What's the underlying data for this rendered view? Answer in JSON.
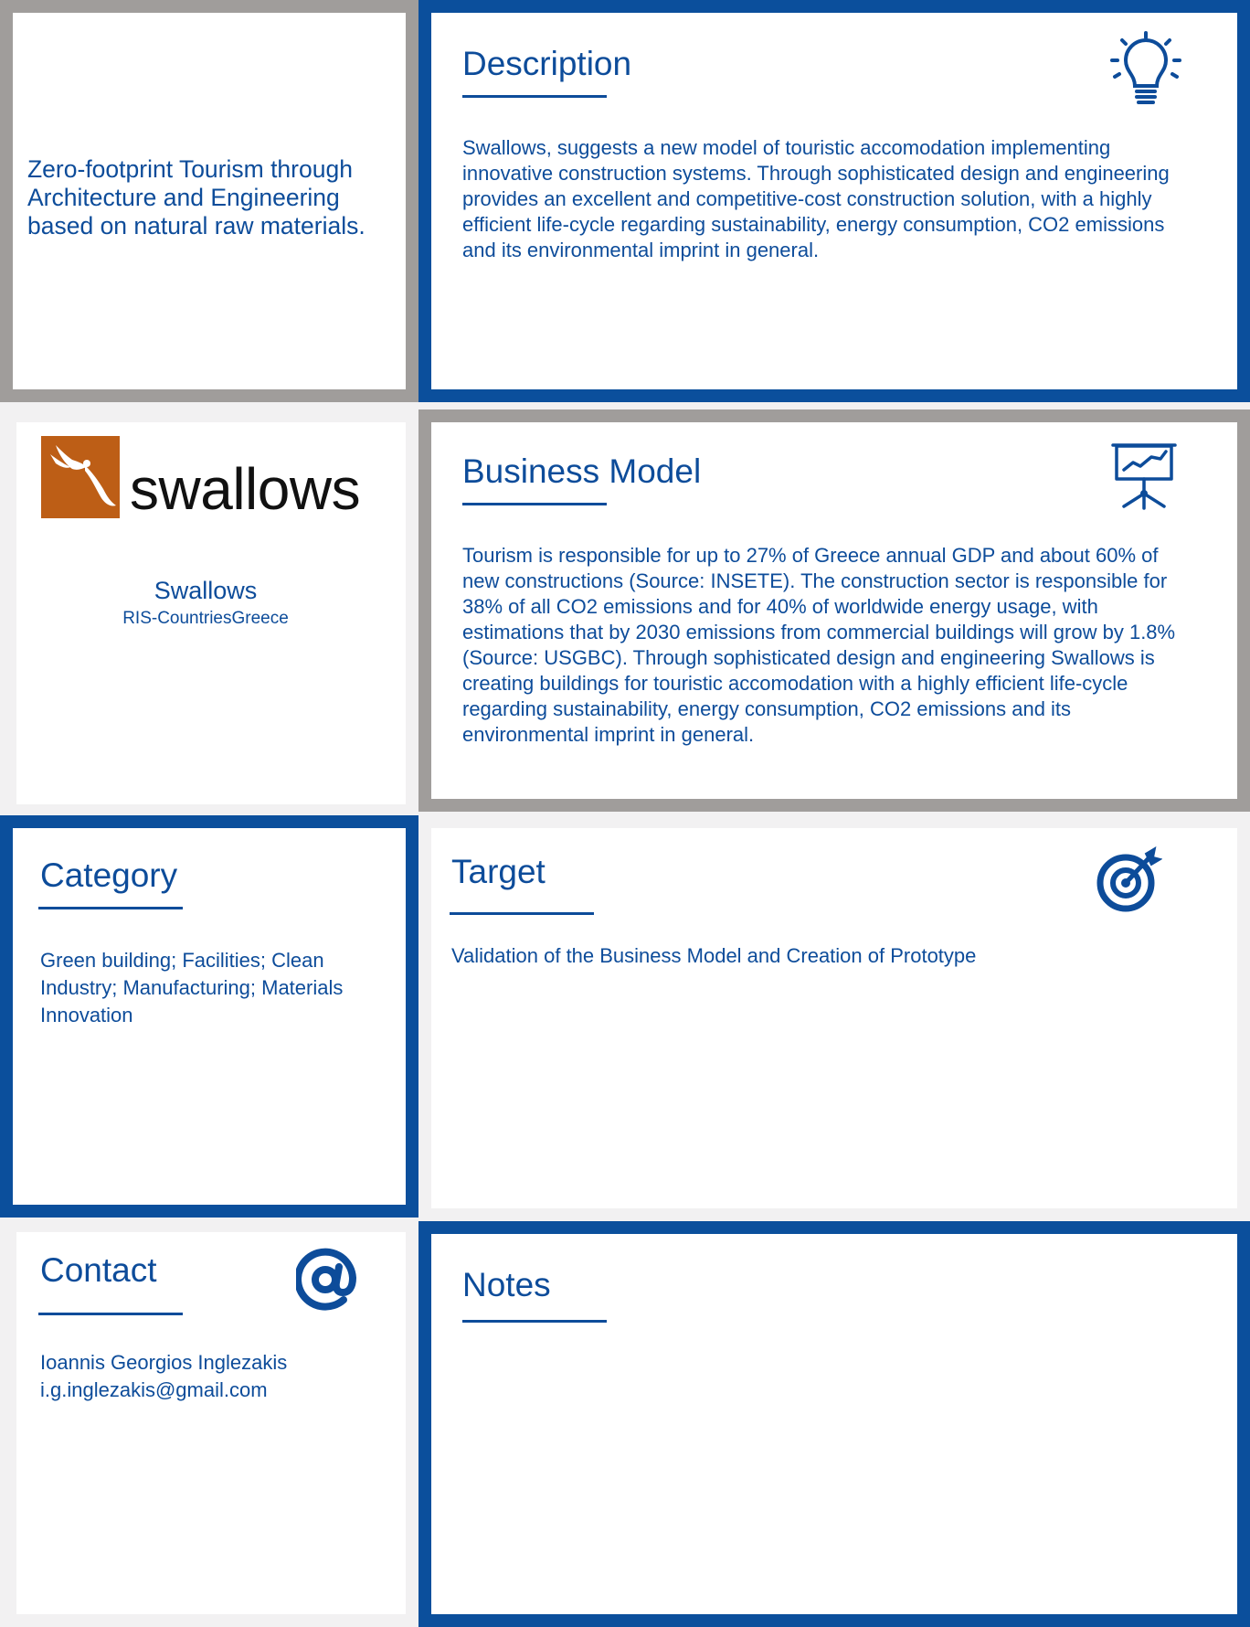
{
  "intro": {
    "tagline": "Zero-footprint Tourism through Architecture and Engineering based on natural raw materials."
  },
  "description": {
    "title": "Description",
    "icon": "lightbulb-icon",
    "text": "Swallows, suggests a new model of touristic accomodation implementing innovative construction systems. Through sophisticated design and engineering provides an excellent and competitive-cost construction solution, with a highly efficient life-cycle regarding sustainability, energy consumption, CO2 emissions and its environmental imprint in general."
  },
  "company": {
    "logo_text": "swallows",
    "name": "Swallows",
    "subtitle": "RIS-CountriesGreece"
  },
  "business_model": {
    "title": "Business Model",
    "icon": "presentation-chart-icon",
    "text": "Tourism is responsible for up to 27% of Greece annual GDP and about 60% of new constructions (Source: INSETE). The construction sector is responsible for 38% of all CO2 emissions and for 40% of worldwide energy usage, with estimations that by 2030 emissions from commercial buildings will grow by 1.8% (Source: USGBC). Through sophisticated design and engineering Swallows is creating buildings for touristic accomodation with a highly efficient life-cycle regarding sustainability, energy consumption, CO2 emissions and its environmental imprint in general."
  },
  "category": {
    "title": "Category",
    "text": "Green building; Facilities; Clean Industry; Manufacturing; Materials Innovation"
  },
  "target": {
    "title": "Target",
    "icon": "target-icon",
    "text": "Validation of the Business Model and Creation of Prototype"
  },
  "contact": {
    "title": "Contact",
    "icon": "at-sign-icon",
    "name": "Ioannis Georgios Inglezakis",
    "email": "i.g.inglezakis@gmail.com"
  },
  "notes": {
    "title": "Notes",
    "text": ""
  },
  "colors": {
    "brand_blue": "#0b4f9c",
    "frame_gray": "#a09d9b",
    "logo_orange": "#bd5e16",
    "background": "#f2f1f2"
  }
}
